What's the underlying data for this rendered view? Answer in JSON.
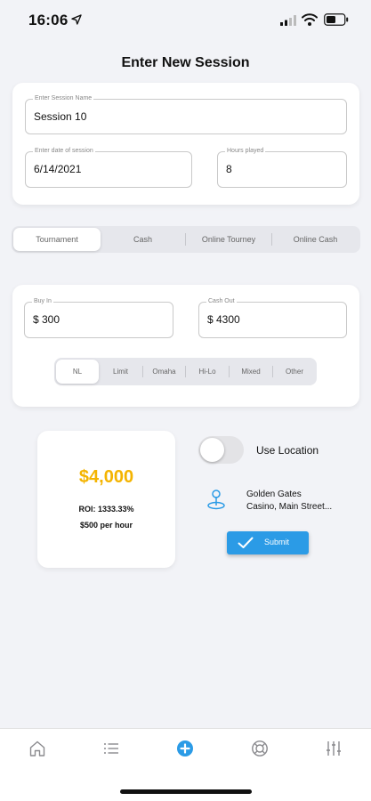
{
  "status_bar": {
    "time": "16:06",
    "icons": [
      "location-arrow-icon",
      "signal-icon",
      "wifi-icon",
      "battery-icon"
    ]
  },
  "page": {
    "title": "Enter New Session"
  },
  "session": {
    "name_label": "Enter Session Name",
    "name_value": "Session 10",
    "date_label": "Enter date of session",
    "date_value": "6/14/2021",
    "hours_label": "Hours played",
    "hours_value": "8"
  },
  "session_type": {
    "options": [
      "Tournament",
      "Cash",
      "Online Tourney",
      "Online Cash"
    ],
    "selected": "Tournament"
  },
  "money": {
    "buyin_label": "Buy In",
    "buyin_value": "$ 300",
    "cashout_label": "Cash Out",
    "cashout_value": "$ 4300"
  },
  "game_type": {
    "options": [
      "NL",
      "Limit",
      "Omaha",
      "Hi-Lo",
      "Mixed",
      "Other"
    ],
    "selected": "NL"
  },
  "result": {
    "amount": "$4,000",
    "roi": "ROI: 1333.33%",
    "rate": "$500 per hour"
  },
  "location": {
    "toggle_label": "Use Location",
    "toggle_on": false,
    "place_line1": "Golden Gates",
    "place_line2": "Casino, Main Street..."
  },
  "submit_label": "Submit",
  "tab_bar": {
    "items": [
      "home-icon",
      "list-icon",
      "add-session-icon",
      "lifebuoy-icon",
      "settings-sliders-icon"
    ],
    "active": "add-session-icon"
  },
  "colors": {
    "accent": "#2b9be6",
    "amount": "#f4b400",
    "background": "#f2f3f7"
  }
}
